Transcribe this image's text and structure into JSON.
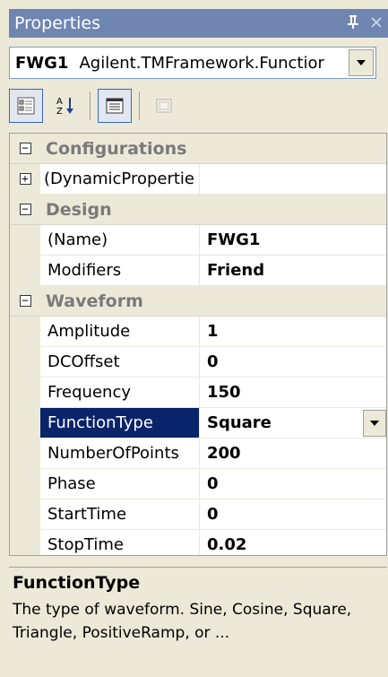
{
  "window": {
    "title": "Properties",
    "pin_icon": "pin-icon",
    "close_icon": "close-icon",
    "title_color": "#6f86b1"
  },
  "object_selector": {
    "name": "FWG1",
    "type": "Agilent.TMFramework.Functior",
    "dropdown_icon": "chevron-down-icon"
  },
  "toolbar": {
    "buttons": [
      {
        "icon": "categorized-icon",
        "pressed": true
      },
      {
        "icon": "alphabetical-icon",
        "pressed": false
      },
      {
        "icon": "properties-icon",
        "pressed": true
      },
      {
        "icon": "property-pages-icon",
        "pressed": false,
        "disabled": true
      }
    ]
  },
  "grid": {
    "categories": [
      {
        "label": "Configurations",
        "expander": "⊟"
      },
      {
        "label": "Design",
        "expander": "⊟"
      },
      {
        "label": "Waveform",
        "expander": "⊟"
      }
    ],
    "dynamic_properties": {
      "label": "(DynamicPropertie",
      "expander": "⊞"
    },
    "design": [
      {
        "name": "(Name)",
        "value": "FWG1"
      },
      {
        "name": "Modifiers",
        "value": "Friend"
      }
    ],
    "waveform": [
      {
        "name": "Amplitude",
        "value": "1"
      },
      {
        "name": "DCOffset",
        "value": "0"
      },
      {
        "name": "Frequency",
        "value": "150"
      },
      {
        "name": "FunctionType",
        "value": "Square",
        "selected": true
      },
      {
        "name": "NumberOfPoints",
        "value": "200"
      },
      {
        "name": "Phase",
        "value": "0"
      },
      {
        "name": "StartTime",
        "value": "0"
      },
      {
        "name": "StopTime",
        "value": "0.02"
      }
    ],
    "selected_color": "#0a246a"
  },
  "description": {
    "title": "FunctionType",
    "text": "The type of waveform.  Sine, Cosine, Square, Triangle, PositiveRamp, or ..."
  }
}
